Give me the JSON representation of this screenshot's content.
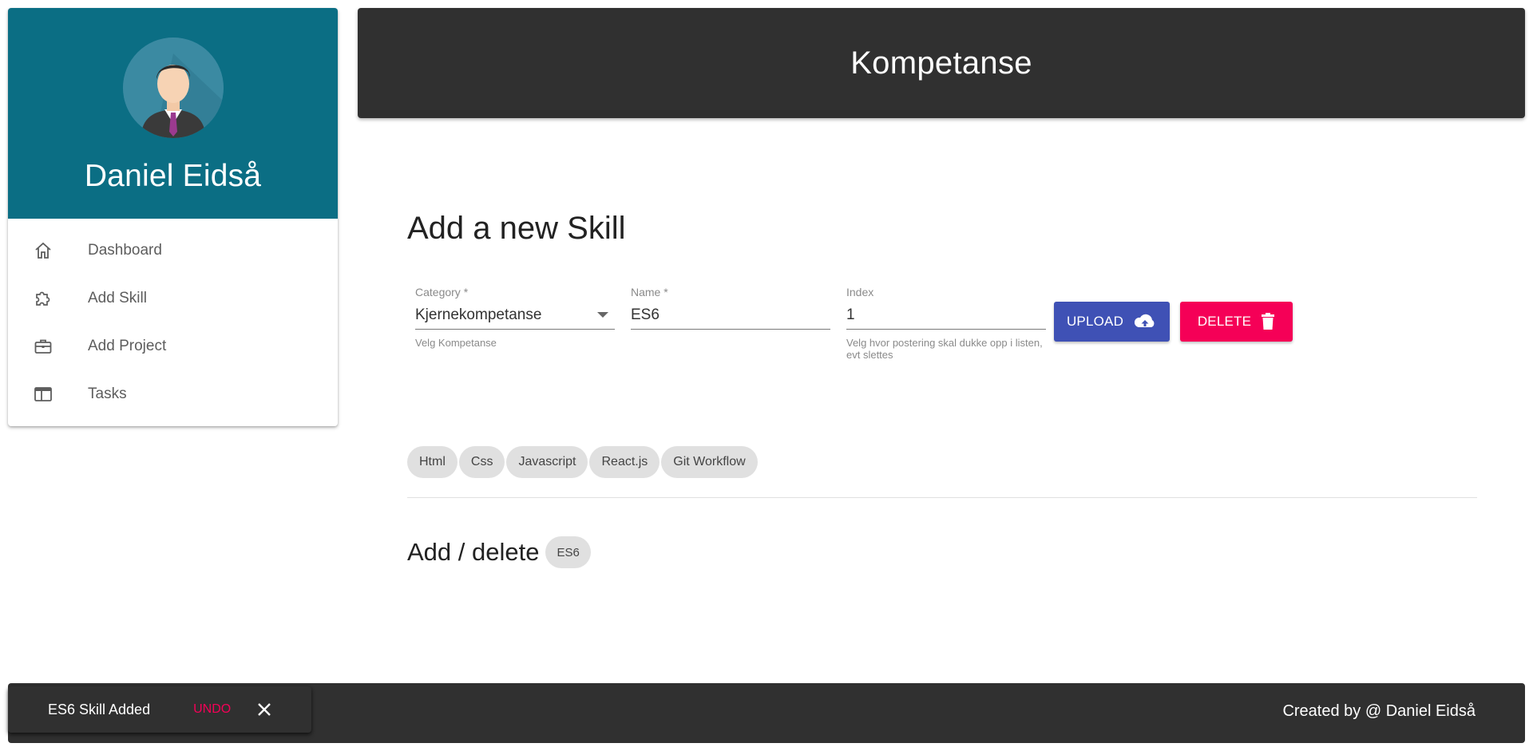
{
  "sidebar": {
    "user_name": "Daniel Eidså",
    "items": [
      {
        "label": "Dashboard",
        "icon": "home-icon"
      },
      {
        "label": "Add Skill",
        "icon": "puzzle-icon"
      },
      {
        "label": "Add Project",
        "icon": "briefcase-icon"
      },
      {
        "label": "Tasks",
        "icon": "web-window-icon"
      }
    ]
  },
  "header": {
    "title": "Kompetanse"
  },
  "form": {
    "title": "Add a new Skill",
    "category": {
      "label": "Category *",
      "value": "Kjernekompetanse",
      "helper": "Velg Kompetanse"
    },
    "name": {
      "label": "Name *",
      "value": "ES6"
    },
    "index": {
      "label": "Index",
      "value": "1",
      "helper": "Velg hvor postering skal dukke opp i listen, evt slettes"
    },
    "upload_label": "UPLOAD",
    "delete_label": "DELETE"
  },
  "skills": [
    "Html",
    "Css",
    "Javascript",
    "React.js",
    "Git Workflow"
  ],
  "add_delete": {
    "title": "Add / delete",
    "chip": "ES6"
  },
  "snackbar": {
    "message": "ES6 Skill Added",
    "undo_label": "UNDO"
  },
  "footer": {
    "text": "Created by @ Daniel Eidså"
  },
  "colors": {
    "profile_bg": "#0b6e84",
    "header_bg": "#303030",
    "upload": "#3f51b5",
    "delete": "#f50057"
  }
}
